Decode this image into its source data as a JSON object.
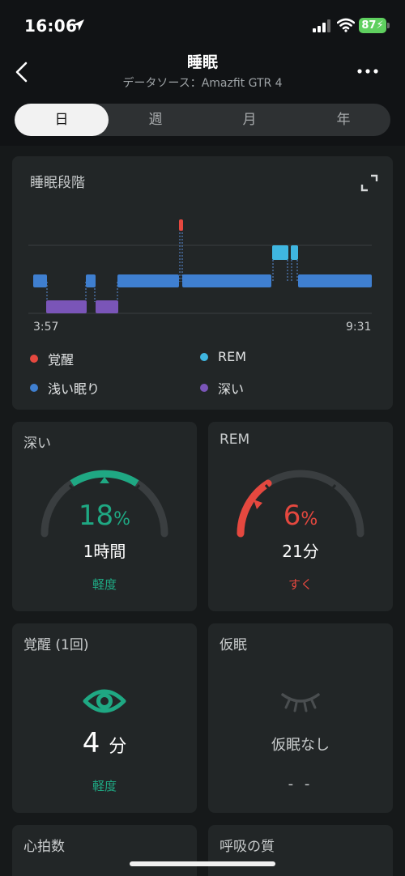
{
  "status_bar": {
    "time": "16:06",
    "battery": "87"
  },
  "header": {
    "title": "睡眠",
    "subtitle": "データソース：Amazfit GTR 4"
  },
  "tabs": [
    {
      "label": "日",
      "active": true
    },
    {
      "label": "週",
      "active": false
    },
    {
      "label": "月",
      "active": false
    },
    {
      "label": "年",
      "active": false
    }
  ],
  "sleep_stages": {
    "title": "睡眠段階",
    "start_time": "3:57",
    "end_time": "9:31",
    "legend": [
      {
        "label": "覚醒",
        "color": "#e5483f"
      },
      {
        "label": "REM",
        "color": "#3fb6e0"
      },
      {
        "label": "浅い眠り",
        "color": "#3f7fd0"
      },
      {
        "label": "深い",
        "color": "#7a55b8"
      }
    ]
  },
  "deep": {
    "title": "深い",
    "percent": "18",
    "percent_unit": "%",
    "duration_num": "1",
    "duration_unit": "時間",
    "rating": "軽度",
    "color": "#1fa883",
    "gauge_fraction": 0.18
  },
  "rem": {
    "title": "REM",
    "percent": "6",
    "percent_unit": "%",
    "duration_num": "21",
    "duration_unit": "分",
    "rating": "すく",
    "color": "#e5483f",
    "gauge_fraction": 0.06
  },
  "awake": {
    "title": "覚醒 (1回)",
    "value": "4",
    "unit": "分",
    "rating": "軽度",
    "color": "#1fa883"
  },
  "nap": {
    "title": "仮眠",
    "text": "仮眠なし",
    "value": "- -"
  },
  "heart_rate": {
    "title": "心拍数"
  },
  "breathing": {
    "title": "呼吸の質"
  },
  "icons": {
    "back": "chevron-left-icon",
    "more": "more-horizontal-icon",
    "expand": "expand-icon",
    "eye": "eye-icon",
    "nap": "closed-eye-icon"
  }
}
